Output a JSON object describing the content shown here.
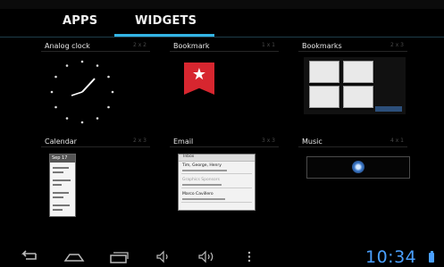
{
  "tabs": [
    {
      "label": "APPS"
    },
    {
      "label": "WIDGETS"
    }
  ],
  "widgets": [
    {
      "name": "Analog clock",
      "dims": "2 x 2"
    },
    {
      "name": "Bookmark",
      "dims": "1 x 1"
    },
    {
      "name": "Bookmarks",
      "dims": "2 x 3"
    },
    {
      "name": "Calendar",
      "dims": "2 x 3"
    },
    {
      "name": "Email",
      "dims": "3 x 3"
    },
    {
      "name": "Music",
      "dims": "4 x 1"
    }
  ],
  "previews": {
    "calendar_date": "Sep 17",
    "email_account": "Inbox",
    "email_senders": [
      "Tim, George, Henry",
      "Graphics Sponsors",
      "Marco Cavillero"
    ]
  },
  "status": {
    "time": "10:34"
  },
  "icons": {
    "back": "back-icon",
    "home": "home-icon",
    "recents": "recent-apps-icon",
    "vol_down": "volume-down-icon",
    "vol_up": "volume-up-icon",
    "menu": "menu-icon",
    "battery": "battery-icon"
  },
  "colors": {
    "accent": "#33b5e5",
    "clock": "#4aa0ff",
    "bookmark_red": "#d7262f"
  }
}
